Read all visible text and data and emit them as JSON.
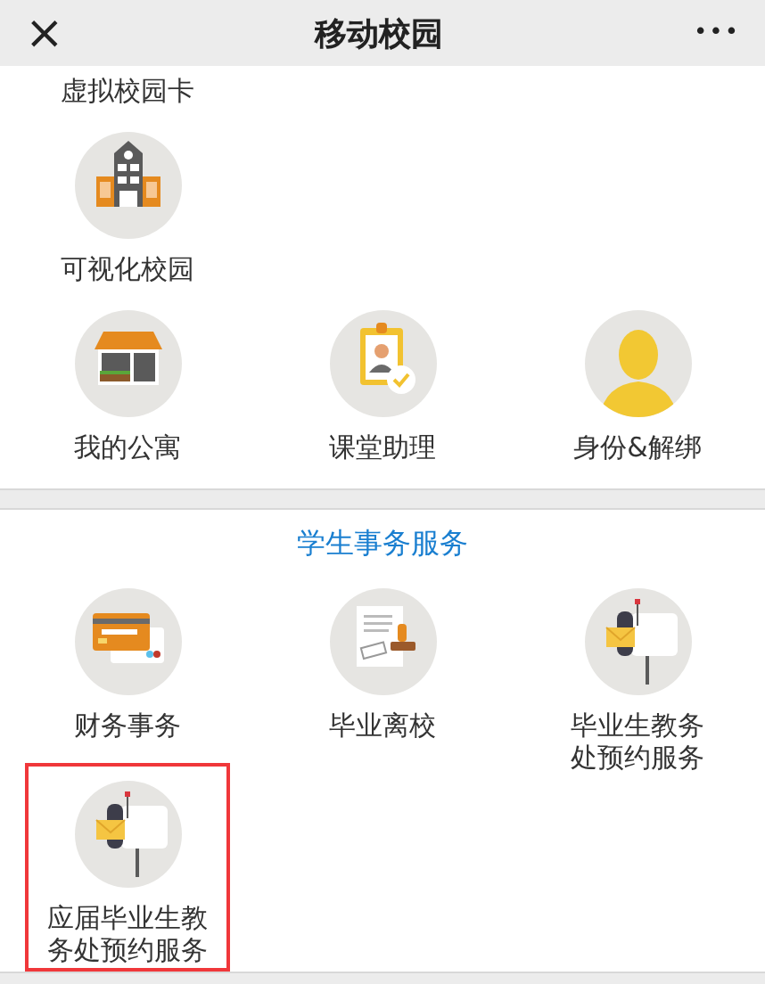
{
  "header": {
    "close_icon": "×",
    "title": "移动校园",
    "more_icon": "•••"
  },
  "sections": [
    {
      "rows": [
        [
          {
            "label": "虚拟校园卡"
          }
        ],
        [
          {
            "label": "可视化校园",
            "kind": "building"
          }
        ],
        [
          {
            "label": "我的公寓",
            "kind": "store"
          },
          {
            "label": "课堂助理",
            "kind": "badge"
          },
          {
            "label": "身份&解绑",
            "kind": "person"
          }
        ]
      ]
    },
    {
      "title": "学生事务服务",
      "rows": [
        [
          {
            "label": "财务事务",
            "kind": "card"
          },
          {
            "label": "毕业离校",
            "kind": "stamp"
          },
          {
            "label": "毕业生教务处预约服务",
            "kind": "mailbox"
          }
        ],
        [
          {
            "label": "应届毕业生教务处预约服务",
            "kind": "mailbox",
            "highlighted": true
          }
        ]
      ]
    }
  ]
}
